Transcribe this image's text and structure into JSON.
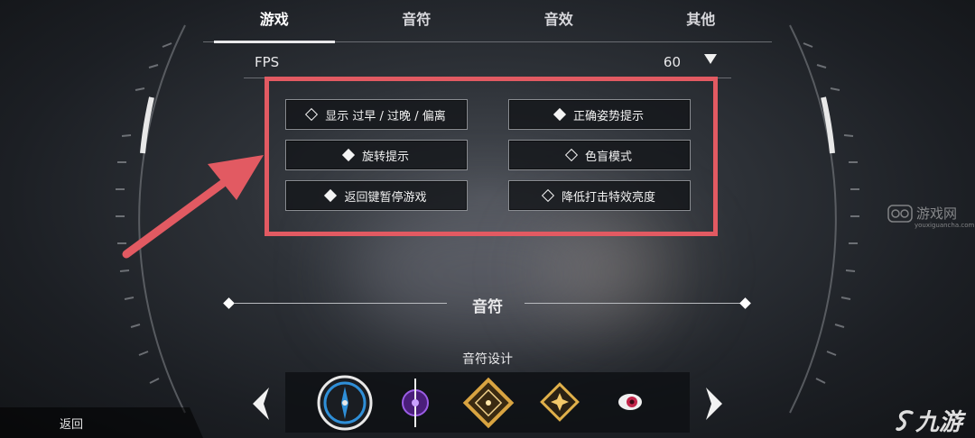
{
  "tabs": [
    {
      "label": "游戏",
      "active": true
    },
    {
      "label": "音符",
      "active": false
    },
    {
      "label": "音效",
      "active": false
    },
    {
      "label": "其他",
      "active": false
    }
  ],
  "fps": {
    "label": "FPS",
    "value": "60"
  },
  "options": [
    {
      "label": "显示 过早 / 过晚 / 偏离",
      "checked": false
    },
    {
      "label": "正确姿势提示",
      "checked": true
    },
    {
      "label": "旋转提示",
      "checked": true
    },
    {
      "label": "色盲模式",
      "checked": false
    },
    {
      "label": "返回键暂停游戏",
      "checked": true
    },
    {
      "label": "降低打击特效亮度",
      "checked": false
    }
  ],
  "section": {
    "title": "音符"
  },
  "note_design": {
    "label": "音符设计",
    "icons": [
      "compass-note-icon",
      "purple-blade-note-icon",
      "gold-diamond-note-icon",
      "gold-star-note-icon",
      "red-orb-note-icon"
    ]
  },
  "footer": {
    "back_label": "返回"
  },
  "watermarks": {
    "top_text": "游戏网",
    "top_sub": "youxiguancha.com",
    "bottom_text": "九游"
  },
  "colors": {
    "highlight_box": "#e25a62",
    "arrow": "#e25a62",
    "accent_gold": "#d9a441",
    "accent_blue": "#2f8fd8"
  }
}
